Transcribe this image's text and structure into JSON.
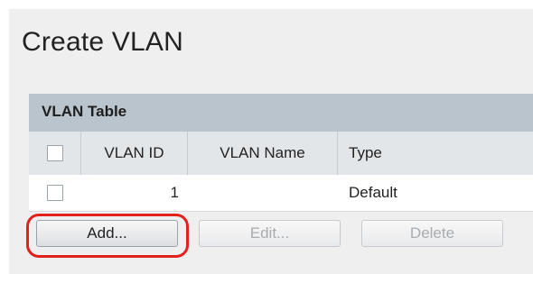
{
  "page": {
    "title": "Create VLAN"
  },
  "vlan_table": {
    "title": "VLAN Table",
    "columns": [
      "VLAN ID",
      "VLAN Name",
      "Type"
    ],
    "rows": [
      {
        "vlan_id": "1",
        "vlan_name": "",
        "type": "Default"
      }
    ]
  },
  "buttons": {
    "add": "Add...",
    "edit": "Edit...",
    "delete": "Delete"
  },
  "colors": {
    "highlight": "#e2211c",
    "table_header": "#b9c4cd",
    "column_header": "#e3e6e9"
  }
}
